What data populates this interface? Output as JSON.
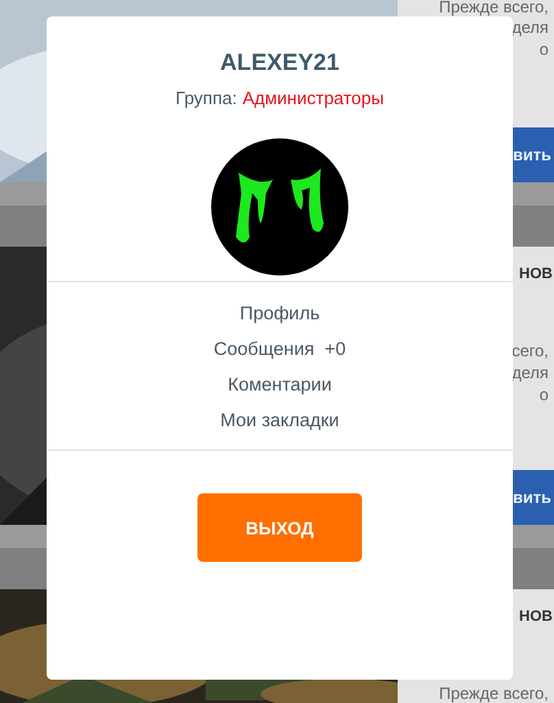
{
  "background": {
    "cards": [
      {
        "kind": "light",
        "lines": [
          "Прежде всего,",
          "деля",
          "о"
        ],
        "button": "вить"
      },
      {
        "kind": "dark",
        "heading": "НОВ",
        "lines": [
          "сего,",
          "деля",
          "о"
        ],
        "button": "вить"
      },
      {
        "kind": "warm",
        "heading": "НОВ",
        "lines": [
          "Прежде всего,"
        ]
      }
    ]
  },
  "profile": {
    "username": "ALEXEY21",
    "group_label": "Группа:",
    "group_name": "Администраторы"
  },
  "menu": [
    {
      "label": "Профиль"
    },
    {
      "label": "Сообщения",
      "count": "+0"
    },
    {
      "label": "Коментарии"
    },
    {
      "label": "Мои закладки"
    }
  ],
  "logout_button": "ВЫХОД"
}
